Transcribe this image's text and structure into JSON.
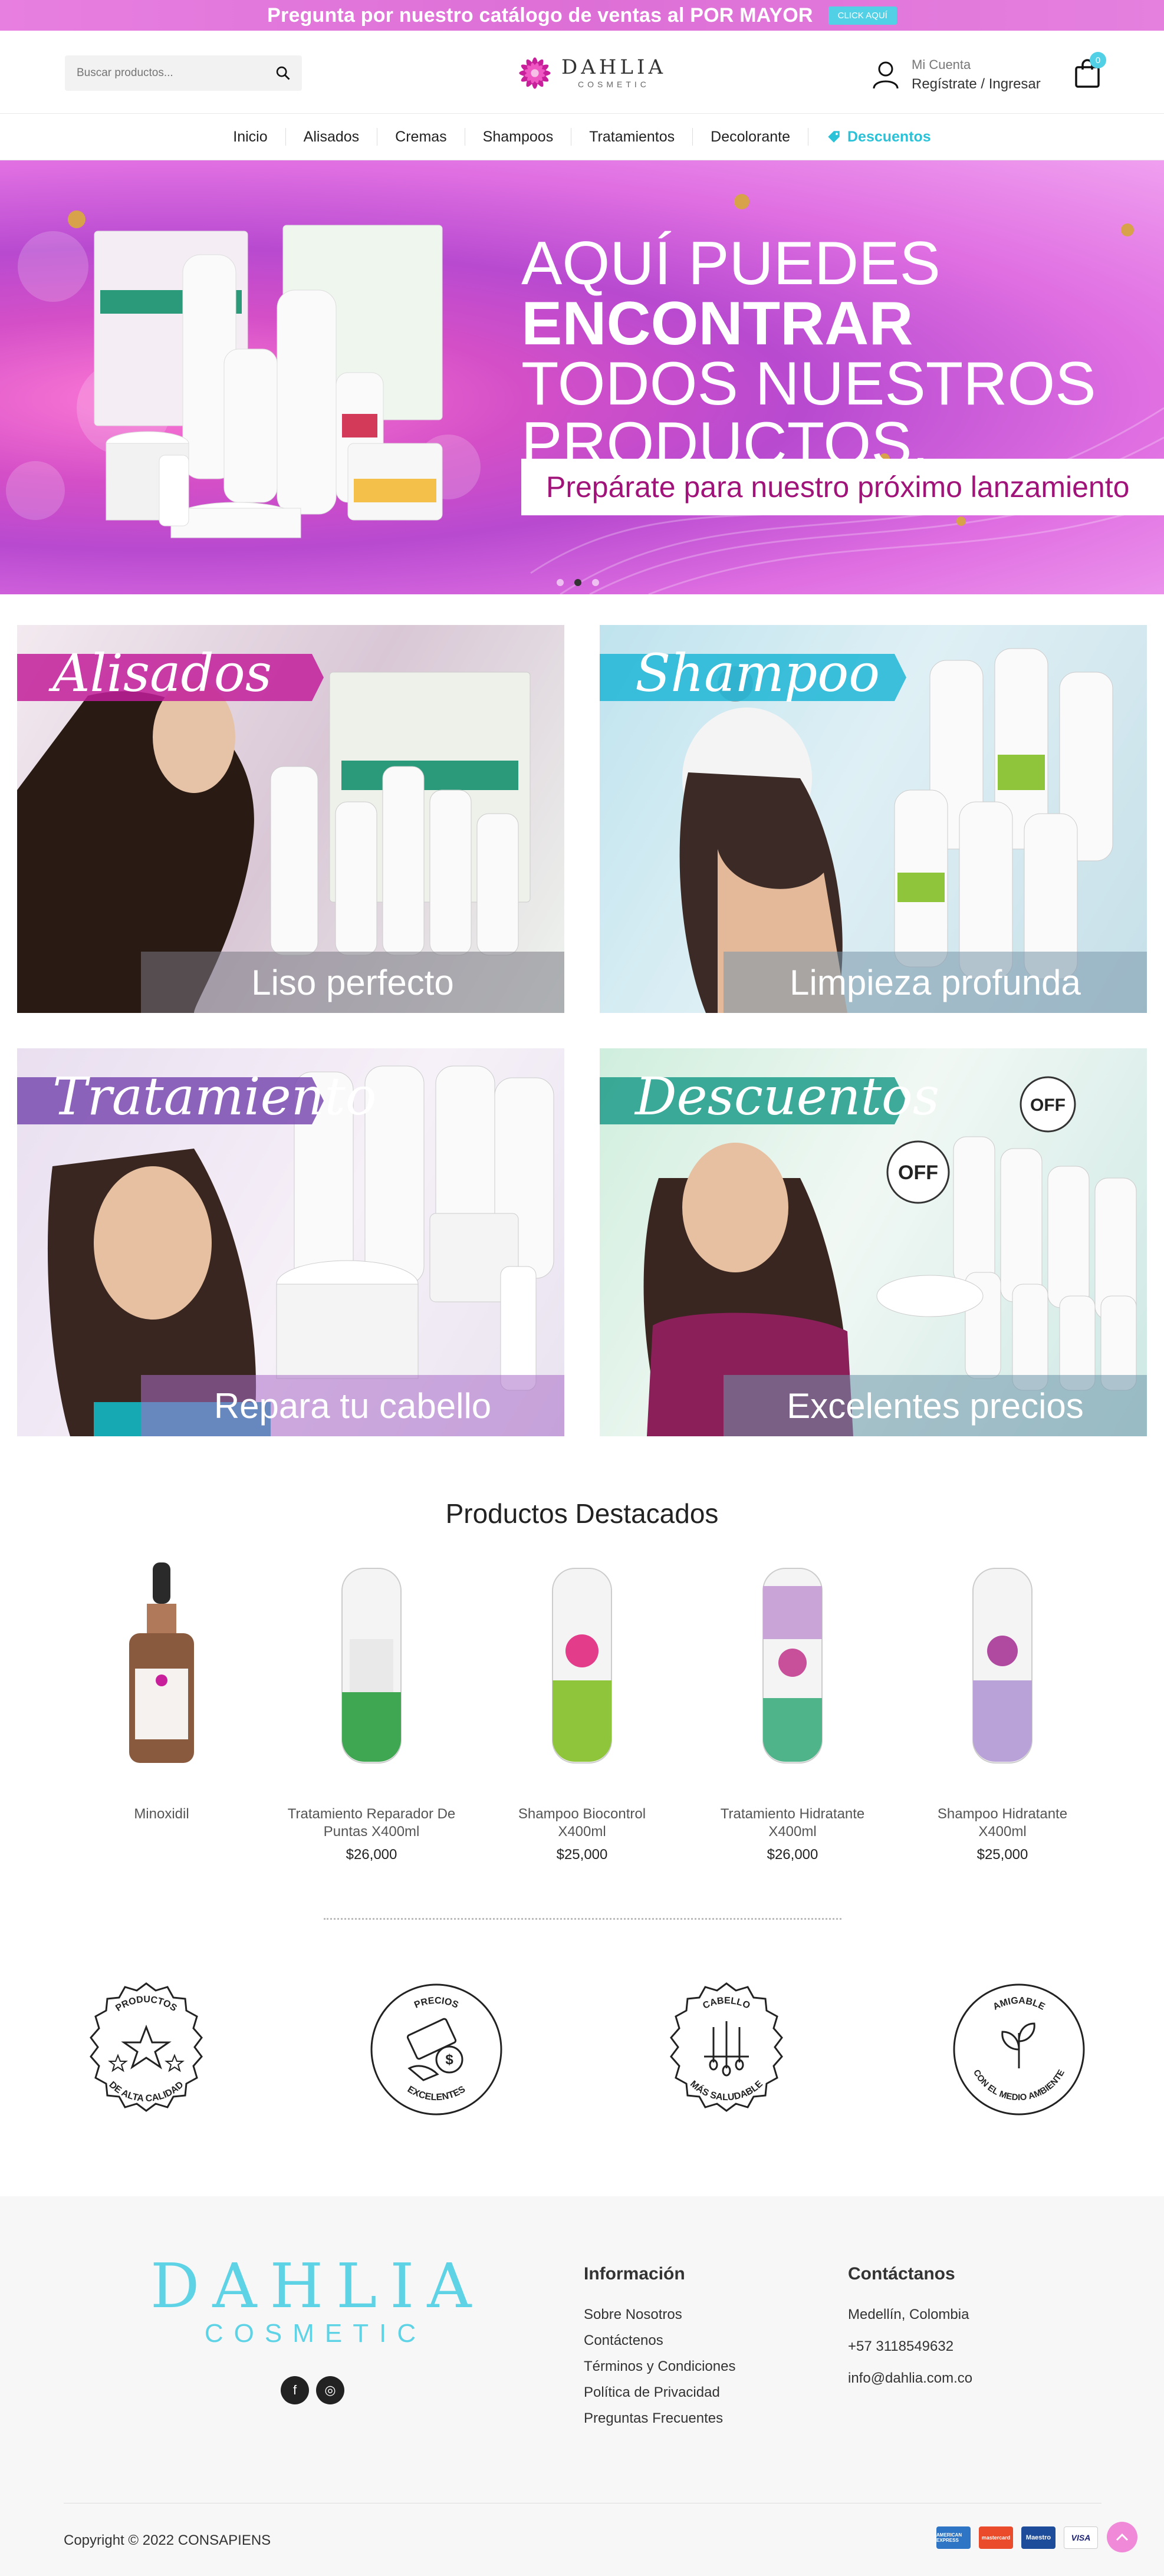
{
  "topbar": {
    "promo_text": "Pregunta por nuestro catálogo de ventas al ",
    "promo_bold": "POR MAYOR",
    "cta": "CLICK AQUÍ"
  },
  "header": {
    "search_placeholder": "Buscar productos...",
    "logo_name": "DAHLIA",
    "logo_sub": "COSMETIC",
    "account_label": "Mi Cuenta",
    "account_action": "Regístrate / Ingresar",
    "cart_count": "0"
  },
  "nav": [
    "Inicio",
    "Alisados",
    "Cremas",
    "Shampoos",
    "Tratamientos",
    "Decolorante",
    "Descuentos"
  ],
  "hero": {
    "line1": "AQUÍ PUEDES",
    "line2": "ENCONTRAR",
    "line3": "TODOS NUESTROS",
    "line4": "PRODUCTOS.",
    "cta": "Prepárate para nuestro próximo lanzamiento",
    "slides": 3,
    "active_slide": 2
  },
  "categories": [
    {
      "title": "Alisados",
      "caption": "Liso perfecto",
      "accent": "#c21f9a"
    },
    {
      "title": "Shampoo",
      "caption": "Limpieza profunda",
      "accent": "#1eb6d6"
    },
    {
      "title": "Tratamiento",
      "caption": "Repara tu cabello",
      "accent": "#7a4bb0"
    },
    {
      "title": "Descuentos",
      "caption": "Excelentes precios",
      "accent": "#1e9c8a"
    }
  ],
  "featured": {
    "title": "Productos Destacados",
    "products": [
      {
        "name": "Minoxidil",
        "price": ""
      },
      {
        "name": "Tratamiento Reparador De Puntas X400ml",
        "price": "$26,000"
      },
      {
        "name": "Shampoo Biocontrol X400ml",
        "price": "$25,000"
      },
      {
        "name": "Tratamiento Hidratante X400ml",
        "price": "$26,000"
      },
      {
        "name": "Shampoo Hidratante X400ml",
        "price": "$25,000"
      }
    ]
  },
  "badges": [
    {
      "top": "PRODUCTOS",
      "bottom": "DE ALTA CALIDAD",
      "icon": "star-icon"
    },
    {
      "top": "PRECIOS",
      "bottom": "EXCELENTES",
      "icon": "money-icon"
    },
    {
      "top": "CABELLO",
      "bottom": "MÁS SALUDABLE",
      "icon": "hair-icon"
    },
    {
      "top": "AMIGABLE",
      "bottom": "CON EL MEDIO AMBIENTE",
      "icon": "leaf-icon"
    }
  ],
  "footer": {
    "logo_name": "DAHLIA",
    "logo_sub": "COSMETIC",
    "social": [
      "f",
      "◎"
    ],
    "info_title": "Información",
    "info_links": [
      "Sobre Nosotros",
      "Contáctenos",
      "Términos y Condiciones",
      "Política de Privacidad",
      "Preguntas Frecuentes"
    ],
    "contact_title": "Contáctanos",
    "contact": [
      "Medellín, Colombia",
      "+57 3118549632",
      "info@dahlia.com.co"
    ],
    "copyright": "Copyright © 2022 CONSAPIENS",
    "payment_cards": [
      "AMERICAN EXPRESS",
      "mastercard",
      "Maestro",
      "VISA"
    ]
  },
  "colors": {
    "brand_pink": "#e77fe0",
    "accent_cyan": "#52d1e6"
  }
}
